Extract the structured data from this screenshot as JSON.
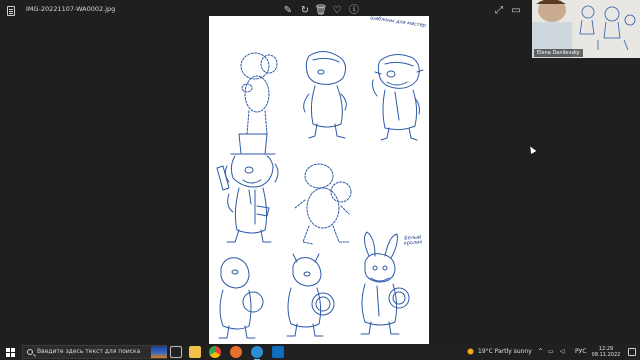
{
  "viewer": {
    "filename": "IMG-20221107-WA0002.jpg",
    "toolbar_icons": [
      "edit-image-icon",
      "rotate-icon",
      "delete-icon",
      "favorite-icon",
      "info-icon",
      "expand-icon",
      "window-icon",
      "close-icon"
    ]
  },
  "sheet": {
    "notes": {
      "top": "шаблоны для мастер",
      "rabbit": "Белый кролик"
    }
  },
  "webcam": {
    "name": "Elena Danilevsky"
  },
  "taskbar": {
    "search_placeholder": "Введите здесь текст для поиска",
    "weather": "19°C  Partly sunny",
    "language": "РУС",
    "time": "12:29",
    "date": "08.11.2022",
    "apps": [
      "task-view-icon",
      "file-explorer-icon",
      "chrome-icon",
      "browser-icon",
      "edge-icon",
      "mail-icon",
      "photos-icon"
    ]
  }
}
